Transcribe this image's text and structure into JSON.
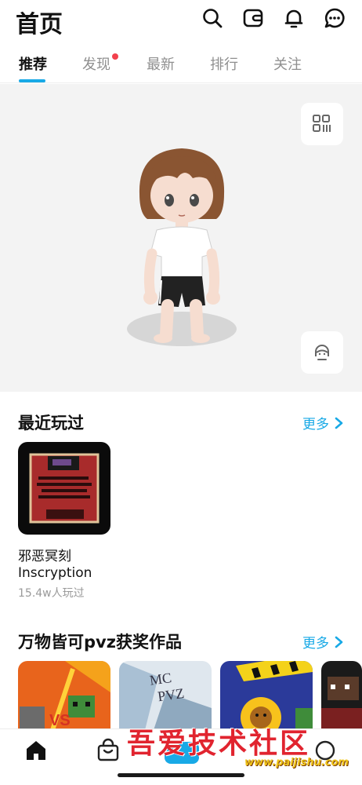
{
  "header": {
    "title": "首页",
    "icons": [
      "search-icon",
      "wallet-icon",
      "bell-icon",
      "message-icon"
    ]
  },
  "tabs": [
    {
      "label": "推荐",
      "active": true
    },
    {
      "label": "发现",
      "active": false,
      "has_dot": true
    },
    {
      "label": "最新",
      "active": false
    },
    {
      "label": "排行",
      "active": false
    },
    {
      "label": "关注",
      "active": false
    }
  ],
  "avatar_panel": {
    "buttons": [
      "grid-code-icon",
      "avatar-face-icon"
    ]
  },
  "recent": {
    "title": "最近玩过",
    "more_label": "更多",
    "game": {
      "name_cn": "邪恶冥刻",
      "name_en": "Inscryption",
      "plays": "15.4w人玩过"
    }
  },
  "awards": {
    "title": "万物皆可pvz获奖作品",
    "more_label": "更多",
    "card_texts": [
      "VS",
      "MC\nPVZ"
    ]
  },
  "bottom_nav": {
    "items": [
      "home-icon",
      "bag-icon",
      "create-icon",
      "profile-icon"
    ]
  },
  "watermark": {
    "title": "吾爱技术社区",
    "url": "www.paijishu.com"
  },
  "colors": {
    "accent": "#18a9e6",
    "dot": "#f2414d",
    "panel_bg": "#f3f3f3"
  }
}
